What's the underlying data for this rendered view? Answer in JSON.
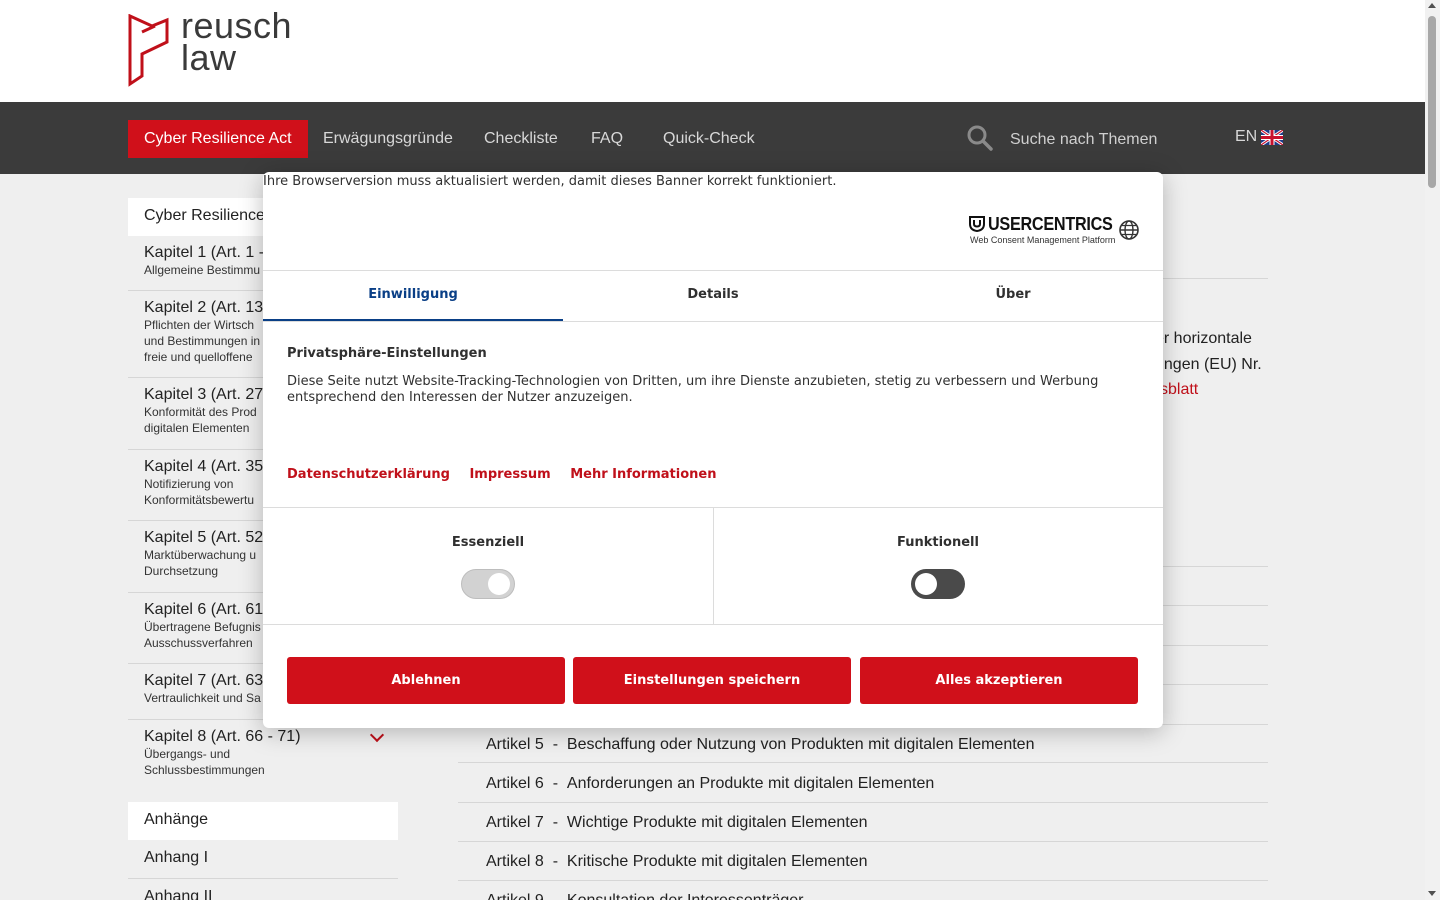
{
  "brand": {
    "logo_line1": "reusch",
    "logo_line2": "law",
    "accent": "#d0101a"
  },
  "nav": {
    "items": [
      "Cyber Resilience Act",
      "Erwägungsgründe",
      "Checkliste",
      "FAQ",
      "Quick-Check"
    ],
    "search_placeholder": "Suche nach Themen",
    "lang": "EN"
  },
  "sidebar": {
    "top": "Cyber Resilience",
    "chapters": [
      {
        "title": "Kapitel 1 (Art. 1 - ",
        "sub": [
          "Allgemeine Bestimmu"
        ]
      },
      {
        "title": "Kapitel 2 (Art. 13",
        "sub": [
          "Pflichten der Wirtsch",
          "und Bestimmungen in",
          "freie und quelloffene"
        ]
      },
      {
        "title": "Kapitel 3 (Art. 27",
        "sub": [
          "Konformität des Prod",
          "digitalen Elementen"
        ]
      },
      {
        "title": "Kapitel 4 (Art. 35",
        "sub": [
          "Notifizierung von",
          "Konformitätsbewertu"
        ]
      },
      {
        "title": "Kapitel 5 (Art. 52",
        "sub": [
          "Marktüberwachung u",
          "Durchsetzung"
        ]
      },
      {
        "title": "Kapitel 6  (Art. 61",
        "sub": [
          "Übertragene Befugnis",
          "Ausschussverfahren"
        ]
      },
      {
        "title": "Kapitel 7 (Art. 63",
        "sub": [
          "Vertraulichkeit und Sa"
        ]
      },
      {
        "title": "Kapitel 8 (Art. 66 - 71)",
        "sub": [
          "Übergangs- und",
          "Schlussbestimmungen"
        ]
      }
    ],
    "annexes_head": "Anhänge",
    "annexes": [
      "Anhang I",
      "Anhang II"
    ]
  },
  "main": {
    "frag1": "er horizontale",
    "frag2": "ungen (EU) Nr.",
    "frag3": "sblatt",
    "articles": [
      {
        "num": "Artikel 5",
        "title": "Beschaffung oder Nutzung von Produkten mit digitalen Elementen"
      },
      {
        "num": "Artikel 6",
        "title": "Anforderungen an Produkte mit digitalen Elementen"
      },
      {
        "num": "Artikel 7",
        "title": "Wichtige Produkte mit digitalen Elementen"
      },
      {
        "num": "Artikel 8",
        "title": "Kritische Produkte mit digitalen Elementen"
      },
      {
        "num": "Artikel 9",
        "title": "Konsultation der Interessenträger"
      }
    ]
  },
  "consent": {
    "notice": "Ihre Browserversion muss aktualisiert werden, damit dieses Banner korrekt funktioniert.",
    "uc_name": "USERCENTRICS",
    "uc_sub": "Web Consent Management Platform",
    "tabs": [
      "Einwilligung",
      "Details",
      "Über"
    ],
    "privacy_title": "Privatsphäre-Einstellungen",
    "privacy_text": "Diese Seite nutzt Website-Tracking-Technologien von Dritten, um ihre Dienste anzubieten, stetig zu verbessern und Werbung entsprechend den Interessen der Nutzer anzuzeigen.",
    "links": [
      "Datenschutzerklärung",
      "Impressum",
      "Mehr Informationen"
    ],
    "categories": [
      {
        "label": "Essenziell",
        "state": "on-disabled"
      },
      {
        "label": "Funktionell",
        "state": "off"
      }
    ],
    "buttons": [
      "Ablehnen",
      "Einstellungen speichern",
      "Alles akzeptieren"
    ]
  }
}
